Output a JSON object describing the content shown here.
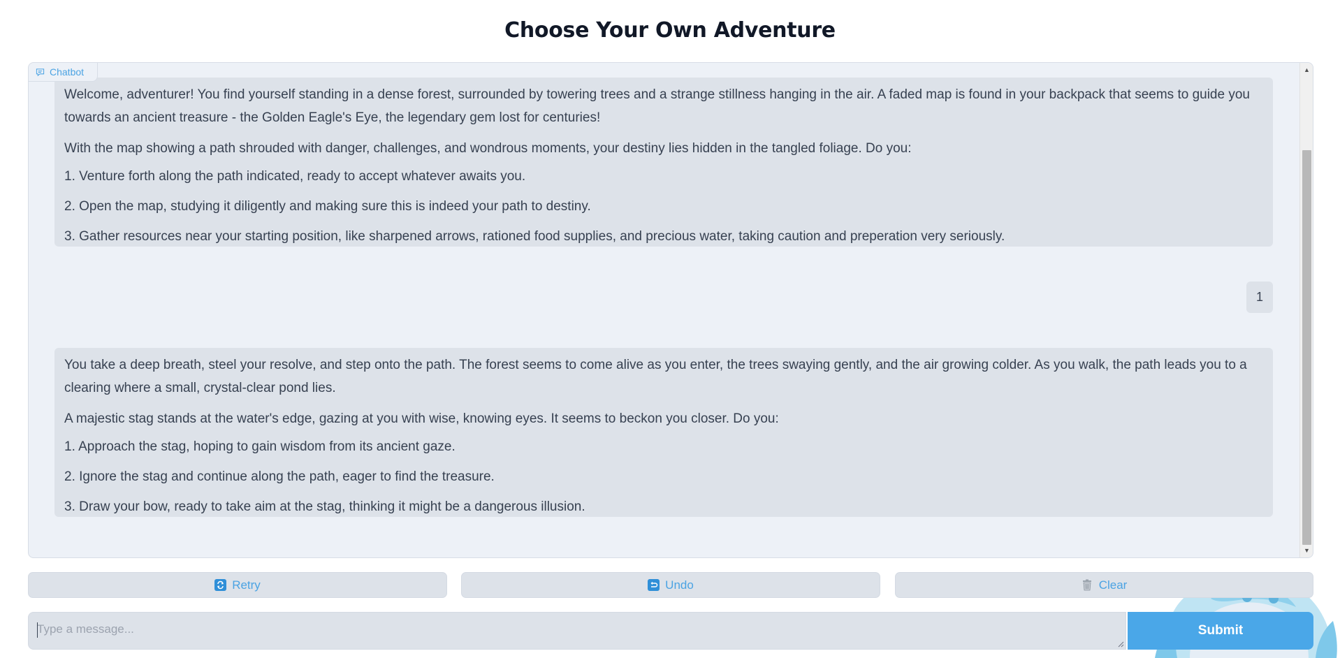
{
  "page": {
    "title": "Choose Your Own Adventure"
  },
  "chatbot": {
    "label": "Chatbot",
    "messages": [
      {
        "role": "bot",
        "paragraphs": [
          "Welcome, adventurer! You find yourself standing in a dense forest, surrounded by towering trees and a strange stillness hanging in the air. A faded map is found in your backpack that seems to guide you towards an ancient treasure - the Golden Eagle's Eye, the legendary gem lost for centuries!",
          "With the map showing a path shrouded with danger, challenges, and wondrous moments, your destiny lies hidden in the tangled foliage. Do you:"
        ],
        "options": [
          "1. Venture forth along the path indicated, ready to accept whatever awaits you.",
          "2. Open the map, studying it diligently and making sure this is indeed your path to destiny.",
          "3. Gather resources near your starting position, like sharpened arrows, rationed food supplies, and precious water, taking caution and preperation very seriously."
        ]
      },
      {
        "role": "user",
        "text": "1"
      },
      {
        "role": "bot",
        "paragraphs": [
          "You take a deep breath, steel your resolve, and step onto the path. The forest seems to come alive as you enter, the trees swaying gently, and the air growing colder. As you walk, the path leads you to a clearing where a small, crystal-clear pond lies.",
          "A majestic stag stands at the water's edge, gazing at you with wise, knowing eyes. It seems to beckon you closer. Do you:"
        ],
        "options": [
          "1. Approach the stag, hoping to gain wisdom from its ancient gaze.",
          "2. Ignore the stag and continue along the path, eager to find the treasure.",
          "3. Draw your bow, ready to take aim at the stag, thinking it might be a dangerous illusion."
        ]
      }
    ]
  },
  "actions": {
    "retry_label": "Retry",
    "undo_label": "Undo",
    "clear_label": "Clear"
  },
  "input": {
    "placeholder": "Type a message...",
    "value": "",
    "submit_label": "Submit"
  },
  "icons": {
    "chat": "chat-bubble-icon",
    "retry": "retry-icon",
    "undo": "undo-icon",
    "clear": "trash-icon"
  },
  "colors": {
    "accent": "#4ba3e3",
    "submit_bg": "#4aa7e8",
    "panel_bg": "#edf1f7",
    "bubble_bg": "#dde2e9"
  }
}
